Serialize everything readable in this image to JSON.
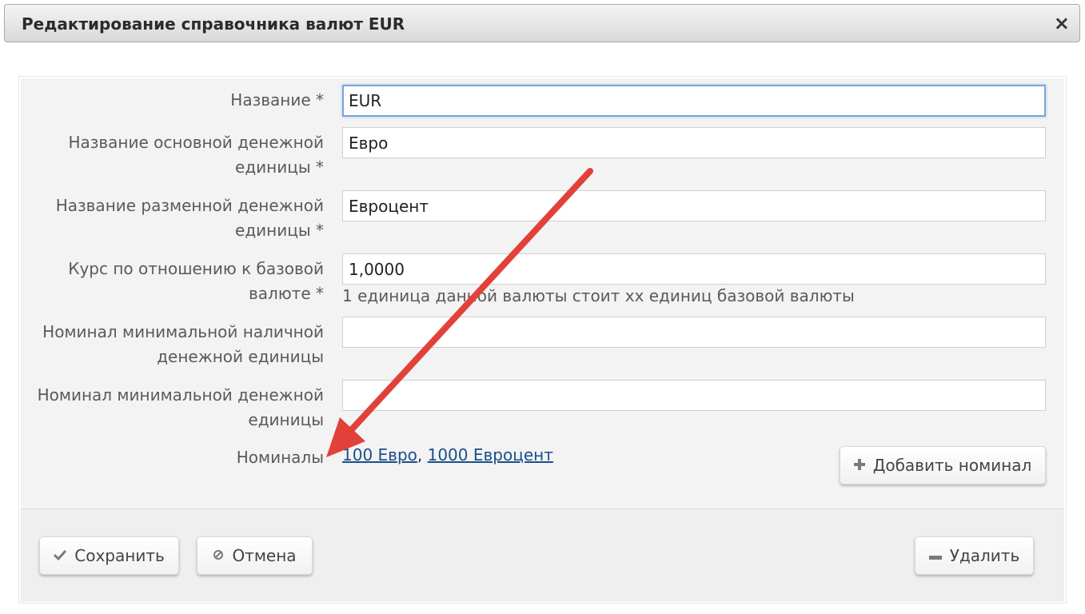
{
  "dialog": {
    "title": "Редактирование справочника валют EUR",
    "close_glyph": "×"
  },
  "form": {
    "name": {
      "label": "Название *",
      "value": "EUR"
    },
    "main_unit": {
      "label": "Название основной денежной единицы *",
      "value": "Евро"
    },
    "fraction_unit": {
      "label": "Название разменной денежной единицы *",
      "value": "Евроцент"
    },
    "rate": {
      "label": "Курс по отношению к базовой валюте *",
      "value": "1,0000",
      "hint": "1 единица данной валюты стоит xx единиц базовой валюты"
    },
    "min_cash_unit": {
      "label": "Номинал минимальной наличной денежной единицы",
      "value": ""
    },
    "min_unit": {
      "label": "Номинал минимальной денежной единицы",
      "value": ""
    },
    "denominations": {
      "label": "Номиналы",
      "items": [
        "100 Евро",
        "1000 Евроцент"
      ],
      "separator": ","
    },
    "add_denomination_label": "Добавить номинал"
  },
  "footer": {
    "save_label": "Сохранить",
    "cancel_label": "Отмена",
    "delete_label": "Удалить"
  },
  "colors": {
    "annotation_arrow": "#e2413a",
    "link": "#1a4f8b",
    "focus_border": "#7aa6d6"
  },
  "icons": {
    "close": "close-icon",
    "plus": "plus-icon",
    "check": "check-icon",
    "cancel": "cancel-circle-icon",
    "minus": "minus-icon"
  }
}
